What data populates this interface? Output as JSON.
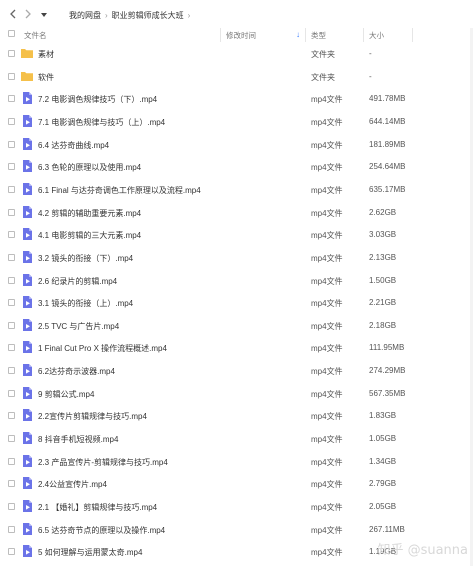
{
  "breadcrumb": [
    "我的网盘",
    "职业剪辑师成长大班"
  ],
  "columns": {
    "name": "文件名",
    "modified": "修改时间",
    "type": "类型",
    "size": "大小"
  },
  "colors": {
    "folder": "#f5c04a",
    "video": "#6b73e8",
    "accent": "#3a7cff"
  },
  "rows": [
    {
      "name": "素材",
      "type": "文件夹",
      "size": "-",
      "icon": "folder-icon"
    },
    {
      "name": "软件",
      "type": "文件夹",
      "size": "-",
      "icon": "folder-icon"
    },
    {
      "name": "7.2 电影调色规律技巧（下）.mp4",
      "type": "mp4文件",
      "size": "491.78MB",
      "icon": "video-file-icon"
    },
    {
      "name": "7.1 电影调色规律与技巧（上）.mp4",
      "type": "mp4文件",
      "size": "644.14MB",
      "icon": "video-file-icon"
    },
    {
      "name": "6.4 达芬奇曲线.mp4",
      "type": "mp4文件",
      "size": "181.89MB",
      "icon": "video-file-icon"
    },
    {
      "name": "6.3 色轮的原理以及使用.mp4",
      "type": "mp4文件",
      "size": "254.64MB",
      "icon": "video-file-icon"
    },
    {
      "name": "6.1 Final 与达芬奇调色工作原理以及流程.mp4",
      "type": "mp4文件",
      "size": "635.17MB",
      "icon": "video-file-icon"
    },
    {
      "name": "4.2 剪辑的辅助重要元素.mp4",
      "type": "mp4文件",
      "size": "2.62GB",
      "icon": "video-file-icon"
    },
    {
      "name": "4.1 电影剪辑的三大元素.mp4",
      "type": "mp4文件",
      "size": "3.03GB",
      "icon": "video-file-icon"
    },
    {
      "name": "3.2 镜头的衔接（下）.mp4",
      "type": "mp4文件",
      "size": "2.13GB",
      "icon": "video-file-icon"
    },
    {
      "name": "2.6 纪录片的剪辑.mp4",
      "type": "mp4文件",
      "size": "1.50GB",
      "icon": "video-file-icon"
    },
    {
      "name": "3.1 镜头的衔接（上）.mp4",
      "type": "mp4文件",
      "size": "2.21GB",
      "icon": "video-file-icon"
    },
    {
      "name": "2.5 TVC 与广告片.mp4",
      "type": "mp4文件",
      "size": "2.18GB",
      "icon": "video-file-icon"
    },
    {
      "name": "1 Final Cut Pro X 操作流程概述.mp4",
      "type": "mp4文件",
      "size": "111.95MB",
      "icon": "video-file-icon"
    },
    {
      "name": "6.2达芬奇示波器.mp4",
      "type": "mp4文件",
      "size": "274.29MB",
      "icon": "video-file-icon"
    },
    {
      "name": "9 剪辑公式.mp4",
      "type": "mp4文件",
      "size": "567.35MB",
      "icon": "video-file-icon"
    },
    {
      "name": "2.2宣传片剪辑规律与技巧.mp4",
      "type": "mp4文件",
      "size": "1.83GB",
      "icon": "video-file-icon"
    },
    {
      "name": "8 抖音手机短视频.mp4",
      "type": "mp4文件",
      "size": "1.05GB",
      "icon": "video-file-icon"
    },
    {
      "name": "2.3 产品宣传片-剪辑规律与技巧.mp4",
      "type": "mp4文件",
      "size": "1.34GB",
      "icon": "video-file-icon"
    },
    {
      "name": "2.4公益宣传片.mp4",
      "type": "mp4文件",
      "size": "2.79GB",
      "icon": "video-file-icon"
    },
    {
      "name": "2.1 【婚礼】剪辑规律与技巧.mp4",
      "type": "mp4文件",
      "size": "2.05GB",
      "icon": "video-file-icon"
    },
    {
      "name": "6.5 达芬奇节点的原理以及操作.mp4",
      "type": "mp4文件",
      "size": "267.11MB",
      "icon": "video-file-icon"
    },
    {
      "name": "5 如何理解与运用蒙太奇.mp4",
      "type": "mp4文件",
      "size": "1.19GB",
      "icon": "video-file-icon"
    }
  ],
  "watermark": "知乎 @suanna"
}
